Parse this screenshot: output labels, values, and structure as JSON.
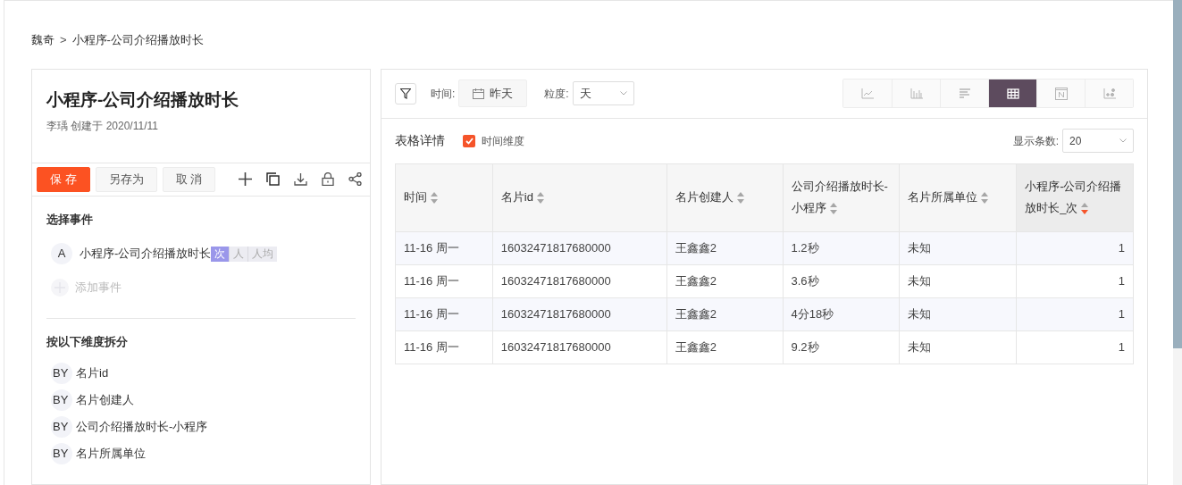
{
  "breadcrumb": [
    "魏奇",
    "小程序-公司介绍播放时长"
  ],
  "breadcrumb_separator": ">",
  "report": {
    "title": "小程序-公司介绍播放时长",
    "meta": "李瑀 创建于 2020/11/11"
  },
  "actions": {
    "buttons": [
      {
        "label": "保 存",
        "kind": "primary"
      },
      {
        "label": "另存为",
        "kind": "plain"
      },
      {
        "label": "取 消",
        "kind": "plain"
      }
    ]
  },
  "events": {
    "heading": "选择事件",
    "items": [
      {
        "letter": "A",
        "name": "小程序-公司介绍播放时长",
        "metrics": [
          {
            "label": "次",
            "selected": true
          },
          {
            "label": "人",
            "selected": false
          },
          {
            "label": "人均",
            "selected": false
          }
        ]
      }
    ],
    "add_label": "添加事件"
  },
  "dimensions": {
    "heading": "按以下维度拆分",
    "items": [
      {
        "prefix": "BY",
        "label": "名片id"
      },
      {
        "prefix": "BY",
        "label": "名片创建人"
      },
      {
        "prefix": "BY",
        "label": "公司介绍播放时长-小程序"
      },
      {
        "prefix": "BY",
        "label": "名片所属单位"
      }
    ]
  },
  "filters": {
    "time_label": "时间:",
    "time_value": "昨天",
    "granularity_label": "粒度:",
    "granularity_value": "天"
  },
  "chart_types": [
    {
      "kind": "line",
      "selected": false
    },
    {
      "kind": "bar",
      "selected": false
    },
    {
      "kind": "hbar",
      "selected": false
    },
    {
      "kind": "table",
      "selected": true
    },
    {
      "kind": "number",
      "selected": false
    },
    {
      "kind": "scatter",
      "selected": false
    }
  ],
  "table_title": "表格详情",
  "time_dimension": {
    "label": "时间维度",
    "checked": true
  },
  "page_size": {
    "label": "显示条数:",
    "value": "20"
  },
  "table": {
    "columns": [
      {
        "label": "时间",
        "sorted": false
      },
      {
        "label": "名片id",
        "sorted": false
      },
      {
        "label": "名片创建人",
        "sorted": false
      },
      {
        "label": "公司介绍播放时长-小程序",
        "sorted": false
      },
      {
        "label": "名片所属单位",
        "sorted": false
      },
      {
        "label": "小程序-公司介绍播放时长_次",
        "sorted": true
      }
    ],
    "rows": [
      [
        "11-16 周一",
        "16032471817680000",
        "王鑫鑫2",
        "1.2秒",
        "未知",
        "1"
      ],
      [
        "11-16 周一",
        "16032471817680000",
        "王鑫鑫2",
        "3.6秒",
        "未知",
        "1"
      ],
      [
        "11-16 周一",
        "16032471817680000",
        "王鑫鑫2",
        "4分18秒",
        "未知",
        "1"
      ],
      [
        "11-16 周一",
        "16032471817680000",
        "王鑫鑫2",
        "9.2秒",
        "未知",
        "1"
      ]
    ]
  }
}
